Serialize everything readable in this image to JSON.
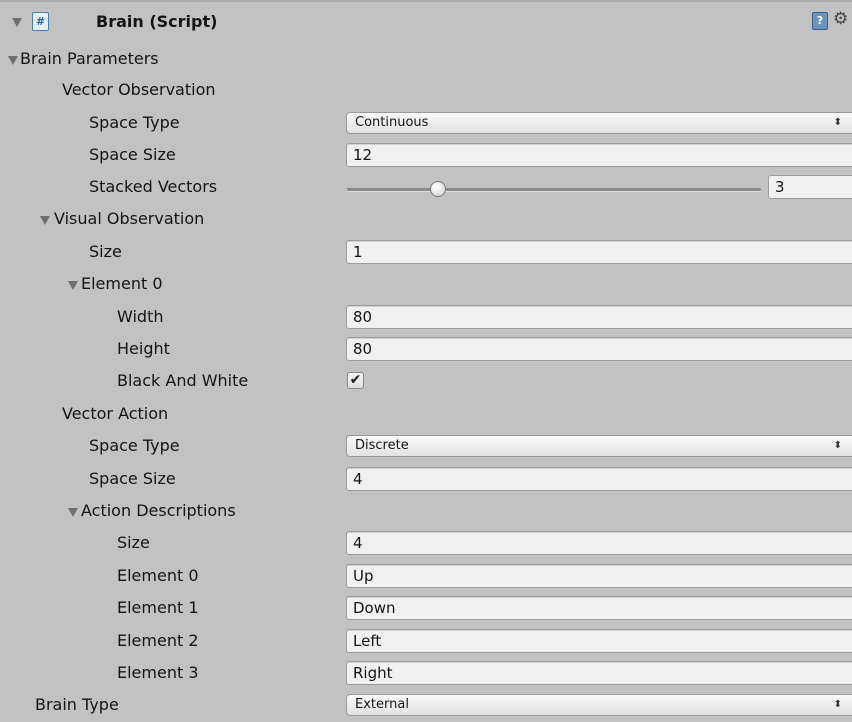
{
  "header": {
    "title": "Brain (Script)",
    "script_icon": "#",
    "help_icon": "?",
    "gear_icon": "⚙"
  },
  "brain_parameters": {
    "label": "Brain Parameters"
  },
  "vector_observation": {
    "label": "Vector Observation",
    "space_type_label": "Space Type",
    "space_type_value": "Continuous",
    "space_size_label": "Space Size",
    "space_size_value": "12",
    "stacked_vectors_label": "Stacked Vectors",
    "stacked_vectors_value": "3",
    "stacked_vectors_fraction": 0.22
  },
  "visual_observation": {
    "label": "Visual Observation",
    "size_label": "Size",
    "size_value": "1",
    "element0": {
      "label": "Element 0",
      "width_label": "Width",
      "width_value": "80",
      "height_label": "Height",
      "height_value": "80",
      "bw_label": "Black And White",
      "bw_checked": true
    }
  },
  "vector_action": {
    "label": "Vector Action",
    "space_type_label": "Space Type",
    "space_type_value": "Discrete",
    "space_size_label": "Space Size",
    "space_size_value": "4",
    "descriptions": {
      "label": "Action Descriptions",
      "size_label": "Size",
      "size_value": "4",
      "elements": [
        {
          "label": "Element 0",
          "value": "Up"
        },
        {
          "label": "Element 1",
          "value": "Down"
        },
        {
          "label": "Element 2",
          "value": "Left"
        },
        {
          "label": "Element 3",
          "value": "Right"
        }
      ]
    }
  },
  "brain_type": {
    "label": "Brain Type",
    "value": "External"
  },
  "select_arrows": "⬍",
  "checkmark": "✔"
}
